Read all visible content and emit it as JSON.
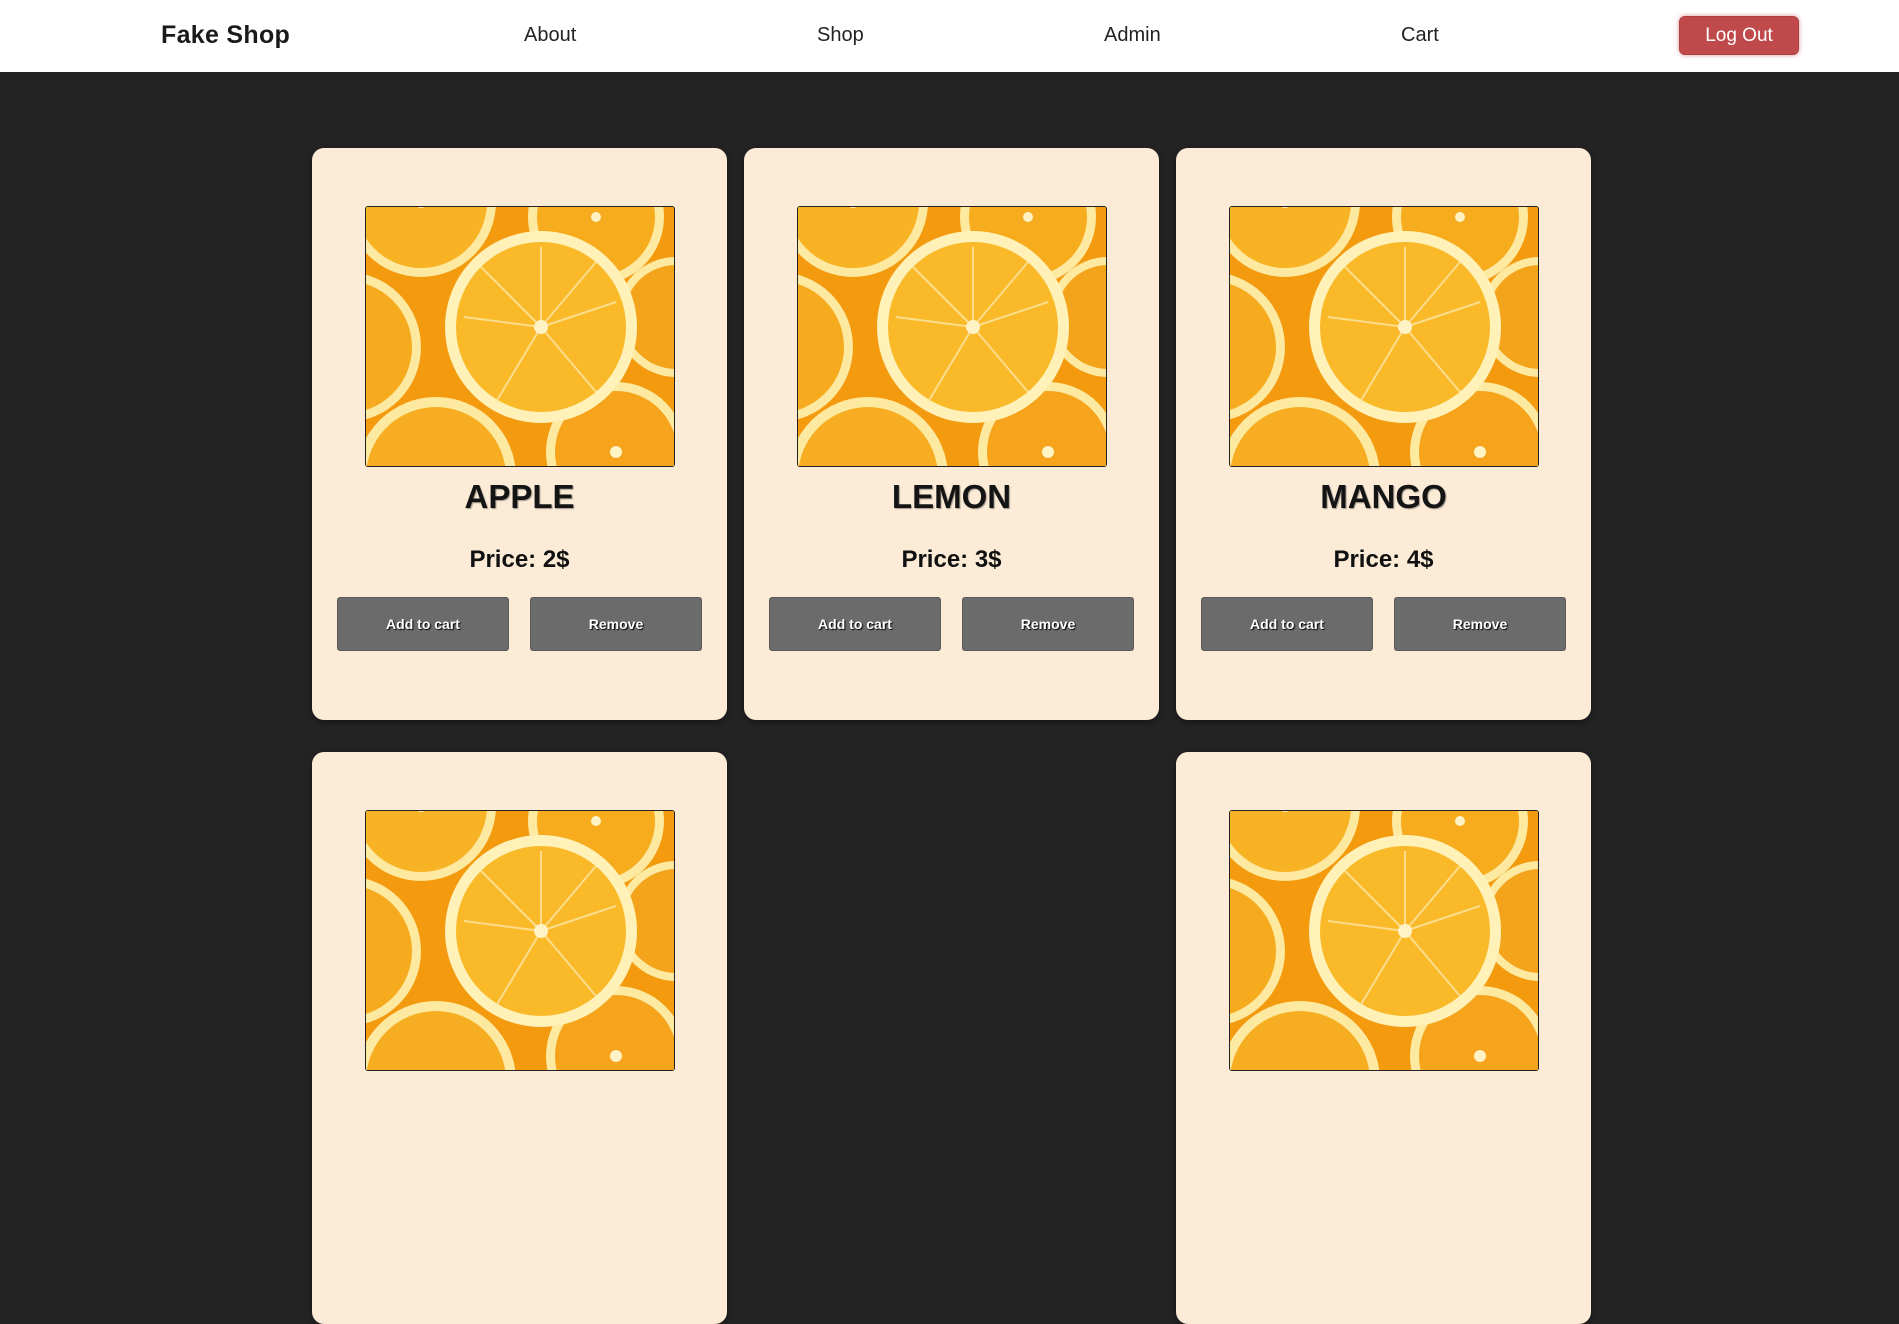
{
  "nav": {
    "brand": "Fake Shop",
    "links": [
      "About",
      "Shop",
      "Admin",
      "Cart"
    ],
    "logout_label": "Log Out"
  },
  "products": [
    {
      "name": "APPLE",
      "price": "Price: 2$",
      "add_label": "Add to cart",
      "remove_label": "Remove"
    },
    {
      "name": "LEMON",
      "price": "Price: 3$",
      "add_label": "Add to cart",
      "remove_label": "Remove"
    },
    {
      "name": "MANGO",
      "price": "Price: 4$",
      "add_label": "Add to cart",
      "remove_label": "Remove"
    }
  ],
  "colors": {
    "page_bg": "#232323",
    "card_bg": "#fbebd7",
    "button_bg": "#6b6b6b",
    "logout_bg": "#c0494b"
  }
}
